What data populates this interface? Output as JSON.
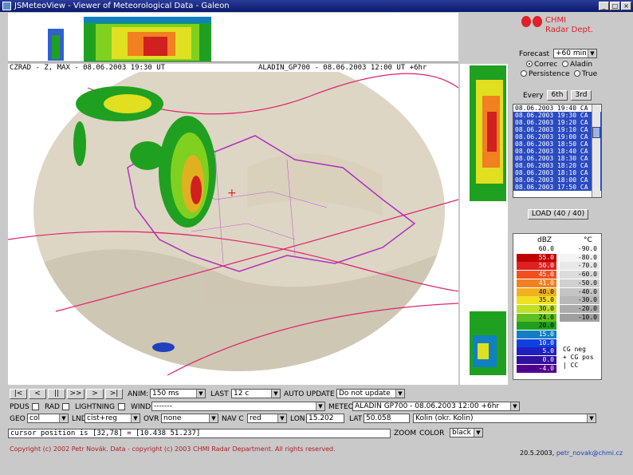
{
  "window": {
    "title": "JSMeteoView - Viewer of Meteorological Data - Galeon",
    "buttons": [
      "_",
      "□",
      "×"
    ]
  },
  "captions": {
    "left": "CZRAD - Z, MAX - 08.06.2003 19:30 UT",
    "right": "ALADIN_GP700 - 08.06.2003 12:00 UT +6hr"
  },
  "logo": {
    "line1": "CHMI",
    "line2": "Radar Dept."
  },
  "forecast": {
    "label": "Forecast",
    "value": "+60 min",
    "radios": [
      {
        "label": "Correc",
        "checked": true
      },
      {
        "label": "Aladin",
        "checked": false
      },
      {
        "label": "Persistence",
        "checked": false
      },
      {
        "label": "True",
        "checked": false
      }
    ]
  },
  "every": {
    "label": "Every",
    "value": "6th",
    "third": "3rd"
  },
  "times": {
    "rows": [
      "08.06.2003 19:40 CA",
      "08.06.2003 19:30 CA",
      "08.06.2003 19:20 CA",
      "08.06.2003 19:10 CA",
      "08.06.2003 19:00 CA",
      "08.06.2003 18:50 CA",
      "08.06.2003 18:40 CA",
      "08.06.2003 18:30 CA",
      "08.06.2003 18:20 CA",
      "08.06.2003 18:10 CA",
      "08.06.2003 18:00 CA",
      "08.06.2003 17:50 CA"
    ],
    "selected_from": 1,
    "load_label": "LOAD (40 / 40)"
  },
  "legend": {
    "left_header": "dBZ",
    "right_header": "°C",
    "left": [
      {
        "label": "60.0",
        "color": "#ffffff"
      },
      {
        "label": "55.0",
        "color": "#c00000"
      },
      {
        "label": "50.0",
        "color": "#e02020"
      },
      {
        "label": "45.0",
        "color": "#f05020"
      },
      {
        "label": "41.0",
        "color": "#f08020"
      },
      {
        "label": "40.0",
        "color": "#f0b020"
      },
      {
        "label": "35.0",
        "color": "#f0e020"
      },
      {
        "label": "30.0",
        "color": "#c0e020"
      },
      {
        "label": "24.0",
        "color": "#60c020"
      },
      {
        "label": "20.0",
        "color": "#20a020"
      },
      {
        "label": "15.0",
        "color": "#1080c0"
      },
      {
        "label": "10.0",
        "color": "#1040e0"
      },
      {
        "label": "5.0",
        "color": "#2020c0"
      },
      {
        "label": "0.0",
        "color": "#3010a0"
      },
      {
        "label": "-4.0",
        "color": "#500090"
      }
    ],
    "right": [
      {
        "label": "-90.0",
        "color": "#ffffff"
      },
      {
        "label": "-80.0",
        "color": "#f4f4f4"
      },
      {
        "label": "-70.0",
        "color": "#e8e8e8"
      },
      {
        "label": "-60.0",
        "color": "#dcdcdc"
      },
      {
        "label": "-50.0",
        "color": "#d0d0d0"
      },
      {
        "label": "-40.0",
        "color": "#c4c4c4"
      },
      {
        "label": "-30.0",
        "color": "#b8b8b8"
      },
      {
        "label": "-20.0",
        "color": "#acacac"
      },
      {
        "label": "-10.0",
        "color": "#a0a0a0"
      }
    ],
    "lightning": [
      {
        "symbol": "",
        "label": "CG neg"
      },
      {
        "symbol": "+",
        "label": "CG pos"
      },
      {
        "symbol": "|",
        "label": "CC"
      }
    ]
  },
  "controls": {
    "nav_buttons": [
      "|<",
      "<",
      "||",
      ">>",
      ">",
      ">|"
    ],
    "anim_label": "ANIM:",
    "anim_value": "150 ms",
    "last_label": "LAST",
    "last_value": "12 c",
    "autoupdate_label": "AUTO UPDATE",
    "autoupdate_value": "Do not update",
    "pdus_label": "PDUS",
    "rad_label": "RAD",
    "lightning_label": "LIGHTNING",
    "wind_label": "WIND",
    "wind_value": "-------",
    "meteo_label": "METEO",
    "meteo_value": "ALADIN GP700 - 08.06.2003 12:00 +6hr",
    "geo_label": "GEO",
    "geo_value": "col",
    "lnd_label": "LND",
    "lnd_value": "cist+reg",
    "ovr_label": "OVR",
    "ovr_value": "none",
    "navc_label": "NAV C",
    "navc_value": "red",
    "lon_label": "LON",
    "lon_value": "15.202",
    "lat_label": "LAT",
    "lat_value": "50.058",
    "place_value": "Kolin (okr. Kolin)",
    "zoom_label": "ZOOM",
    "color_label": "COLOR",
    "color_value": "black"
  },
  "status": {
    "text": "cursor position is [32,78] = [10.438 51.237]"
  },
  "footer": {
    "copyright": "Copyright (c) 2002 Petr Novák. Data - copyright (c) 2003 CHMI Radar Department. All rights reserved.",
    "date": "20.5.2003,",
    "email": "petr_novak@chmi.cz"
  },
  "map": {
    "background_color": "#e8e0d0",
    "border_color": "#b030c0",
    "isoline_color": "#e0206a"
  }
}
